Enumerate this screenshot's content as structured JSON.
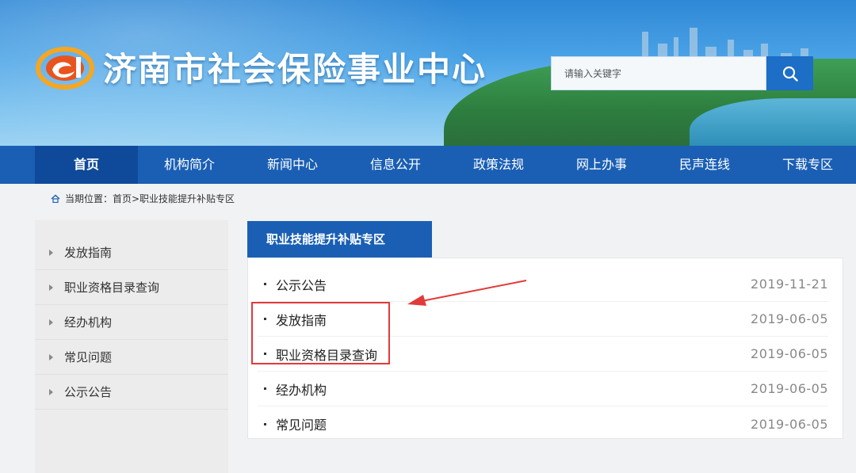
{
  "header": {
    "site_title": "济南市社会保险事业中心",
    "logo_name": "si-logo",
    "search": {
      "placeholder": "请输入关键字",
      "value": ""
    }
  },
  "nav": {
    "items": [
      {
        "label": "首页",
        "active": true
      },
      {
        "label": "机构简介"
      },
      {
        "label": "新闻中心"
      },
      {
        "label": "信息公开"
      },
      {
        "label": "政策法规"
      },
      {
        "label": "网上办事"
      },
      {
        "label": "民声连线"
      },
      {
        "label": "下载专区"
      }
    ]
  },
  "breadcrumb": {
    "text": "当期位置：首页>职业技能提升补贴专区"
  },
  "sidebar": {
    "items": [
      {
        "label": "发放指南"
      },
      {
        "label": "职业资格目录查询"
      },
      {
        "label": "经办机构"
      },
      {
        "label": "常见问题"
      },
      {
        "label": "公示公告"
      }
    ]
  },
  "main": {
    "tab_title": "职业技能提升补贴专区",
    "list": [
      {
        "title": "公示公告",
        "date": "2019-11-21"
      },
      {
        "title": "发放指南",
        "date": "2019-06-05"
      },
      {
        "title": "职业资格目录查询",
        "date": "2019-06-05"
      },
      {
        "title": "经办机构",
        "date": "2019-06-05"
      },
      {
        "title": "常见问题",
        "date": "2019-06-05"
      }
    ]
  },
  "colors": {
    "nav_bg": "#1a5fb4",
    "nav_active": "#0f4a9a",
    "annotation": "#e23a3a"
  },
  "icons": [
    "si-logo",
    "search-icon",
    "home-icon",
    "triangle-right-icon"
  ]
}
